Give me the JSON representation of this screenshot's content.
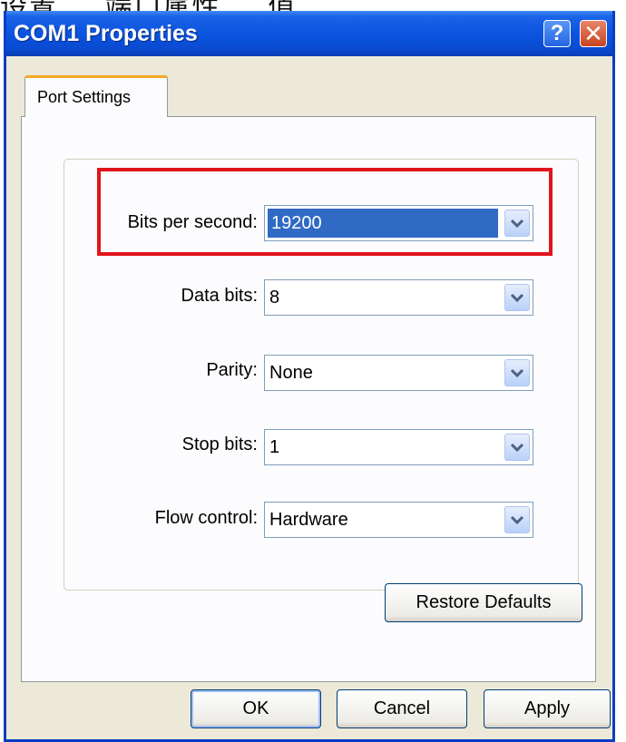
{
  "background_text": "设置 ... 端口属性 ... 值",
  "window": {
    "title": "COM1 Properties",
    "help_label": "?",
    "close_label": "✕"
  },
  "tab": {
    "label": "Port Settings"
  },
  "fields": [
    {
      "label": "Bits per second:",
      "value": "19200",
      "selected": true
    },
    {
      "label": "Data bits:",
      "value": "8"
    },
    {
      "label": "Parity:",
      "value": "None"
    },
    {
      "label": "Stop bits:",
      "value": "1"
    },
    {
      "label": "Flow control:",
      "value": "Hardware"
    }
  ],
  "buttons": {
    "restore_defaults": "Restore Defaults",
    "ok": "OK",
    "cancel": "Cancel",
    "apply": "Apply"
  },
  "icons": {
    "dropdown": "chevron-down-icon",
    "help": "help-icon",
    "close": "close-icon"
  },
  "colors": {
    "titlebar": "#0b54e0",
    "highlight": "#e1151b",
    "selection": "#316ac5",
    "tab_accent": "#f5a623"
  }
}
